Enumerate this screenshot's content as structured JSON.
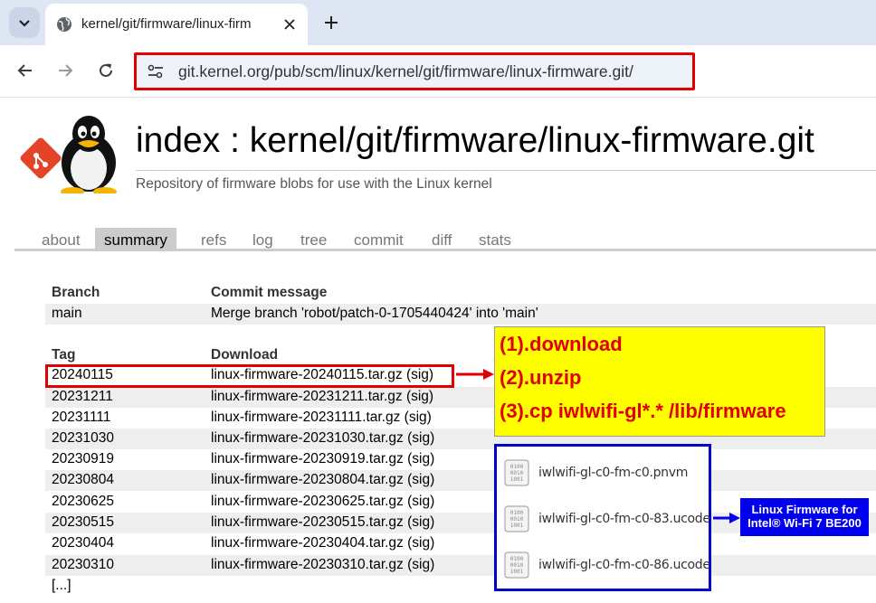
{
  "browser": {
    "tab_title": "kernel/git/firmware/linux-firm",
    "url": "git.kernel.org/pub/scm/linux/kernel/git/firmware/linux-firmware.git/",
    "icons": [
      "chevron-down-icon",
      "globe-icon",
      "close-icon",
      "plus-icon",
      "back-arrow-icon",
      "forward-arrow-icon",
      "reload-icon",
      "site-settings-icon"
    ]
  },
  "header": {
    "title": "index : kernel/git/firmware/linux-firmware.git",
    "description": "Repository of firmware blobs for use with the Linux kernel"
  },
  "nav_tabs": [
    {
      "label": "about"
    },
    {
      "label": "summary",
      "active": true
    },
    {
      "label": "refs"
    },
    {
      "label": "log"
    },
    {
      "label": "tree"
    },
    {
      "label": "commit"
    },
    {
      "label": "diff"
    },
    {
      "label": "stats"
    }
  ],
  "branches": {
    "col_branch": "Branch",
    "col_message": "Commit message",
    "rows": [
      {
        "name": "main",
        "message": "Merge branch 'robot/patch-0-1705440424' into 'main'"
      }
    ]
  },
  "tags": {
    "col_tag": "Tag",
    "col_download": "Download",
    "rows": [
      {
        "tag": "20240115",
        "download": "linux-firmware-20240115.tar.gz (sig)"
      },
      {
        "tag": "20231211",
        "download": "linux-firmware-20231211.tar.gz (sig)"
      },
      {
        "tag": "20231111",
        "download": "linux-firmware-20231111.tar.gz (sig)"
      },
      {
        "tag": "20231030",
        "download": "linux-firmware-20231030.tar.gz (sig)"
      },
      {
        "tag": "20230919",
        "download": "linux-firmware-20230919.tar.gz (sig)"
      },
      {
        "tag": "20230804",
        "download": "linux-firmware-20230804.tar.gz (sig)"
      },
      {
        "tag": "20230625",
        "download": "linux-firmware-20230625.tar.gz (sig)"
      },
      {
        "tag": "20230515",
        "download": "linux-firmware-20230515.tar.gz (sig)"
      },
      {
        "tag": "20230404",
        "download": "linux-firmware-20230404.tar.gz (sig)"
      },
      {
        "tag": "20230310",
        "download": "linux-firmware-20230310.tar.gz (sig)"
      }
    ],
    "more": "[...]"
  },
  "annotation": {
    "steps": [
      "(1).download",
      "(2).unzip",
      "(3).cp iwlwifi-gl*.* /lib/firmware"
    ],
    "files": [
      "iwlwifi-gl-c0-fm-c0.pnvm",
      "iwlwifi-gl-c0-fm-c0-83.ucode",
      "iwlwifi-gl-c0-fm-c0-86.ucode"
    ],
    "file_icon_bits": [
      "0100",
      "0010",
      "1001"
    ],
    "label_line1": "Linux Firmware for",
    "label_line2": "Intel® Wi-Fi 7 BE200",
    "colors": {
      "red": "#e00000",
      "yellow": "#ffff00",
      "blue": "#0000ee"
    }
  }
}
